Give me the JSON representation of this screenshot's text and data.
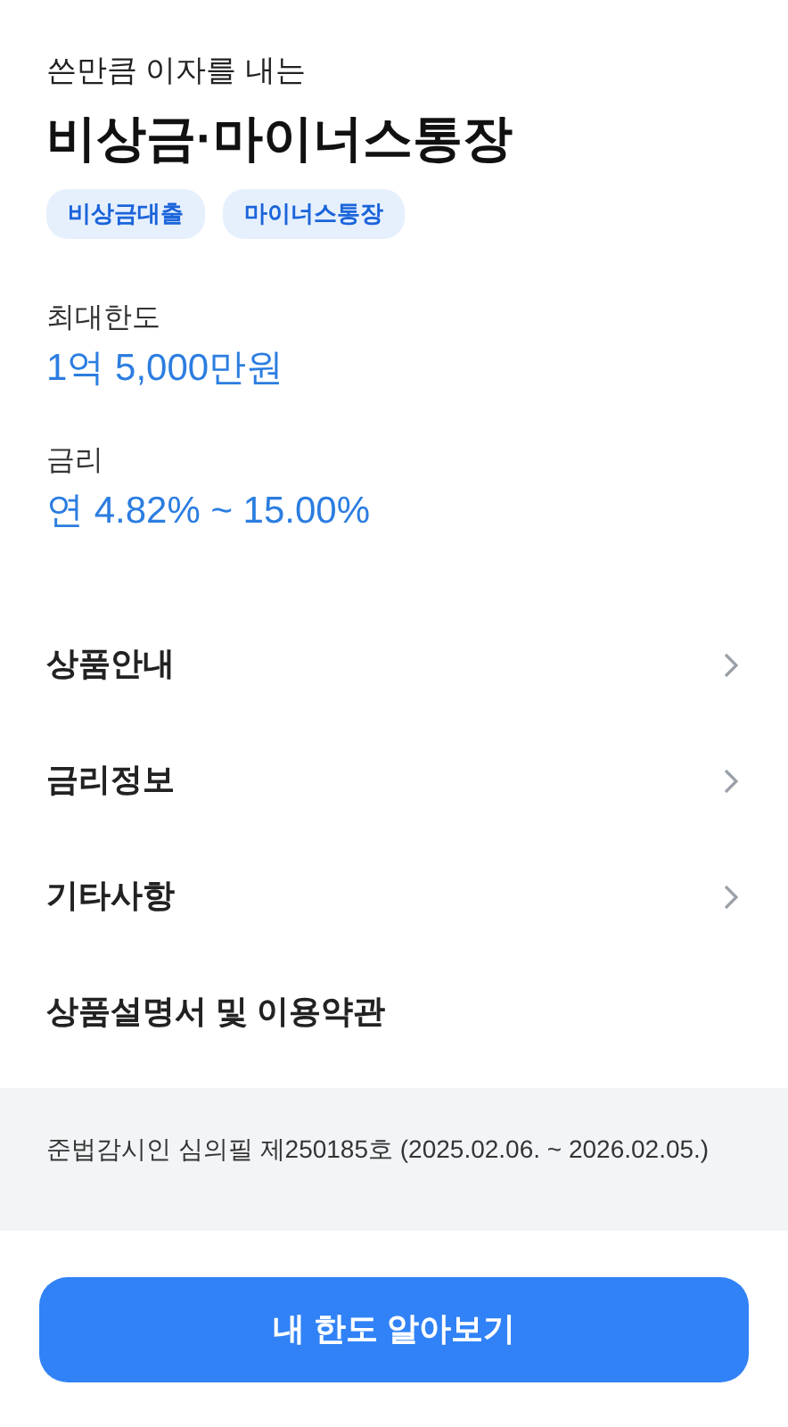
{
  "subtitle": "쓴만큼 이자를 내는",
  "title": "비상금·마이너스통장",
  "tags": [
    "비상금대출",
    "마이너스통장"
  ],
  "facts": [
    {
      "label": "최대한도",
      "value": "1억 5,000만원"
    },
    {
      "label": "금리",
      "value": "연 4.82% ~ 15.00%"
    }
  ],
  "menu": [
    {
      "label": "상품안내",
      "kind": "link"
    },
    {
      "label": "금리정보",
      "kind": "link"
    },
    {
      "label": "기타사항",
      "kind": "link"
    },
    {
      "label": "상품설명서 및 이용약관",
      "kind": "plain"
    }
  ],
  "notice": "준법감시인 심의필 제250185호 (2025.02.06. ~ 2026.02.05.)",
  "cta": "내 한도 알아보기"
}
